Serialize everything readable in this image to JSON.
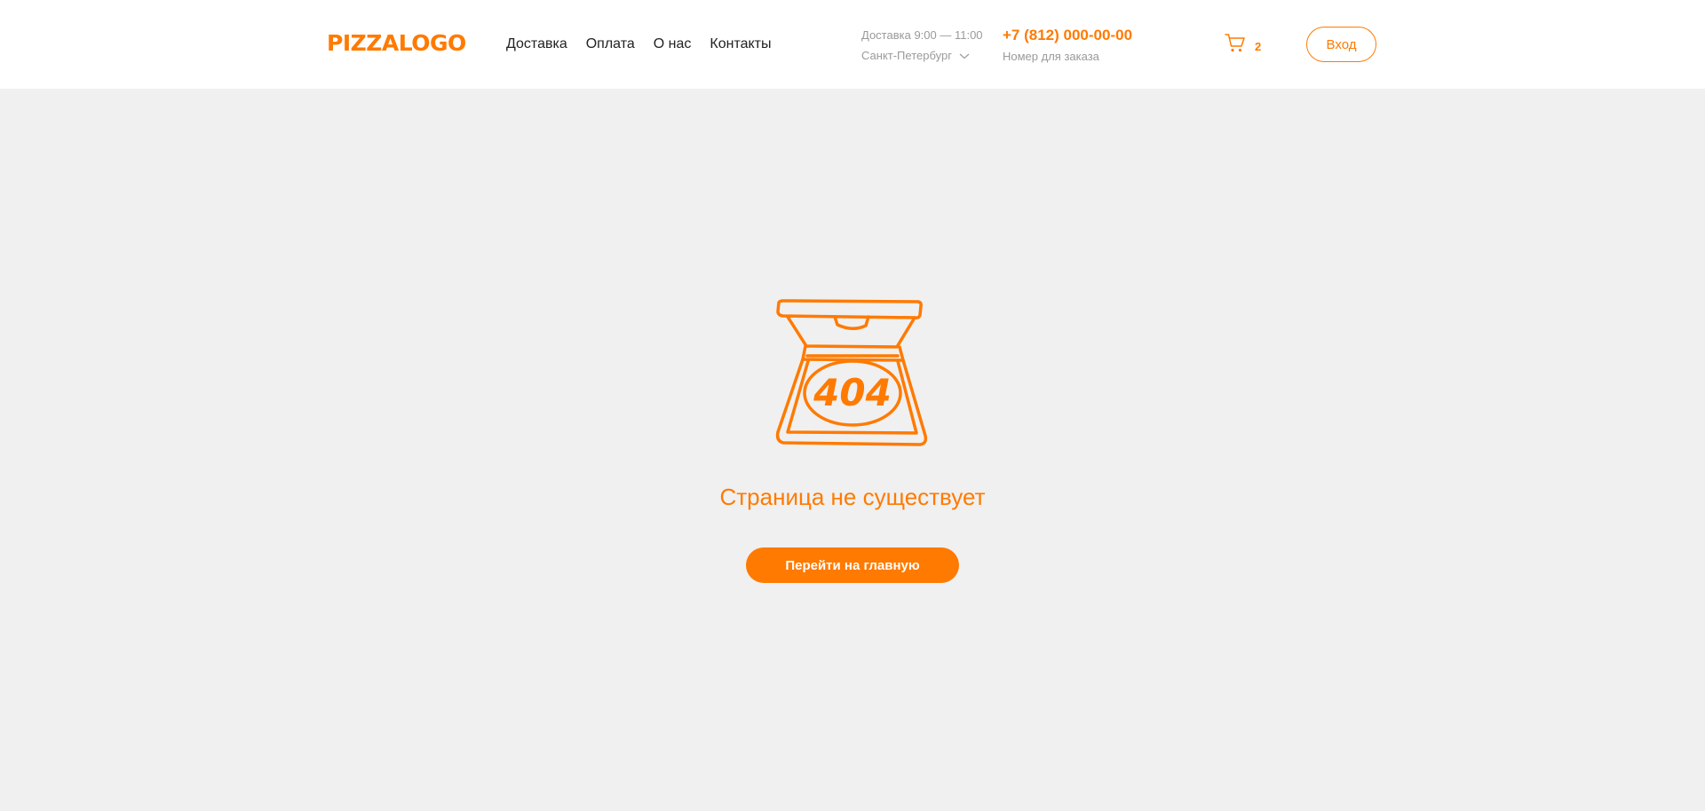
{
  "header": {
    "logo": "PIZZALOGO",
    "nav": [
      "Доставка",
      "Оплата",
      "О нас",
      "Контакты"
    ],
    "delivery_hours": "Доставка 9:00 — 11:00",
    "city": "Санкт-Петербург",
    "phone": "+7 (812) 000-00-00",
    "phone_caption": "Номер для заказа",
    "cart_count": "2",
    "login_label": "Вход"
  },
  "main": {
    "error_code": "404",
    "message": "Страница не существует",
    "home_button": "Перейти на главную"
  },
  "colors": {
    "accent": "#ff7a00",
    "background": "#f0f0f0",
    "header_bg": "#ffffff",
    "muted_text": "#9a9a9a"
  },
  "icons": {
    "cart": "cart-icon",
    "city_dropdown": "chevron-down-icon",
    "illustration": "pizza-box-404-illustration"
  }
}
